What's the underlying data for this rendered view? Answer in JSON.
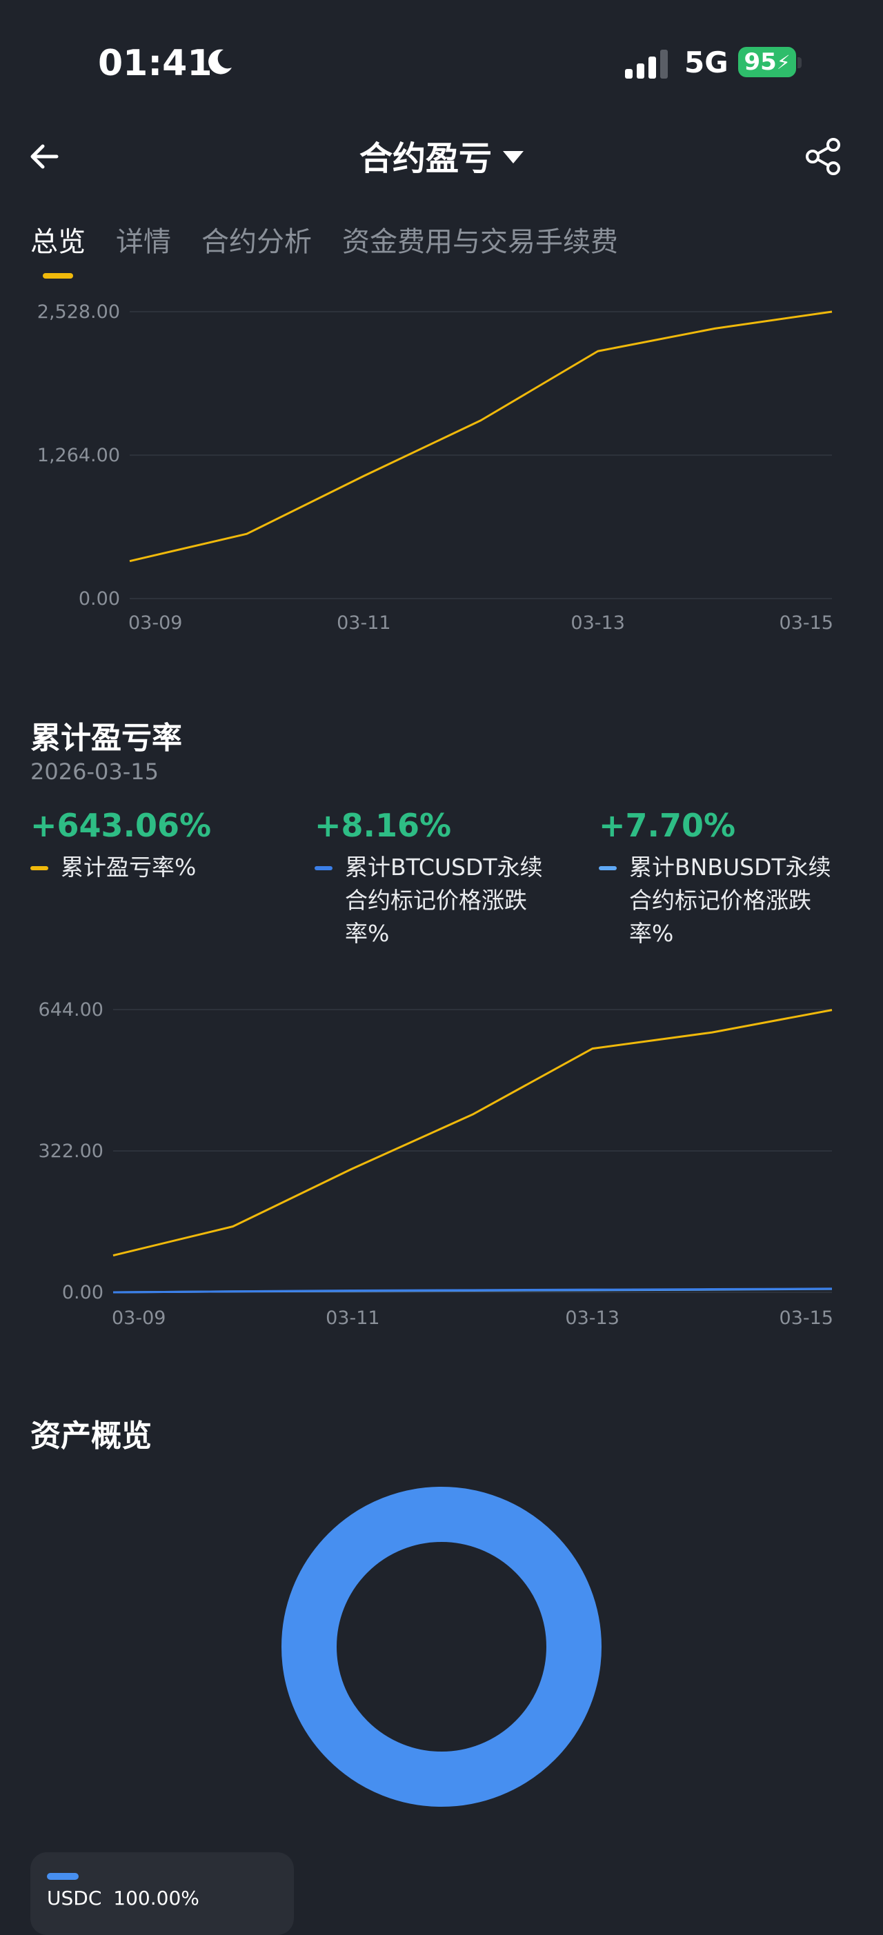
{
  "status_bar": {
    "time": "01:41",
    "network": "5G",
    "battery": "95"
  },
  "header": {
    "title": "合约盈亏"
  },
  "tabs": [
    {
      "label": "总览",
      "active": true
    },
    {
      "label": "详情",
      "active": false
    },
    {
      "label": "合约分析",
      "active": false
    },
    {
      "label": "资金费用与交易手续费",
      "active": false
    }
  ],
  "chart_data": [
    {
      "type": "line",
      "x": [
        "03-09",
        "03-10",
        "03-11",
        "03-12",
        "03-13",
        "03-14",
        "03-15"
      ],
      "series": [
        {
          "values": [
            330,
            570,
            1080,
            1570,
            2180,
            2380,
            2528
          ]
        }
      ],
      "ylim": [
        0,
        2528
      ],
      "yticks": [
        "0.00",
        "1,264.00",
        "2,528.00"
      ],
      "xticks": [
        "03-09",
        "03-11",
        "03-13",
        "03-15"
      ],
      "grid": true
    },
    {
      "type": "line",
      "x": [
        "03-09",
        "03-10",
        "03-11",
        "03-12",
        "03-13",
        "03-14",
        "03-15"
      ],
      "series": [
        {
          "name": "累计盈亏率%",
          "values": [
            84,
            150,
            282,
            405,
            555,
            592,
            643.06
          ]
        },
        {
          "name": "累计BTCUSDT永续合约标记价格涨跌率%",
          "values": [
            0,
            2,
            4,
            5,
            6,
            7,
            8.16
          ]
        },
        {
          "name": "累计BNBUSDT永续合约标记价格涨跌率%",
          "values": [
            0,
            2,
            3,
            4,
            5,
            6,
            7.7
          ]
        }
      ],
      "ylim": [
        0,
        644
      ],
      "yticks": [
        "0.00",
        "322.00",
        "644.00"
      ],
      "xticks": [
        "03-09",
        "03-11",
        "03-13",
        "03-15"
      ],
      "grid": true
    },
    {
      "type": "pie",
      "categories": [
        "USDC"
      ],
      "values": [
        100.0
      ]
    }
  ],
  "cumulative": {
    "title": "累计盈亏率",
    "date": "2026-03-15",
    "stats": [
      {
        "value": "+643.06%",
        "label": "累计盈亏率%",
        "color": "#f0b90b"
      },
      {
        "value": "+8.16%",
        "label": "累计BTCUSDT永续合约标记价格涨跌率%",
        "color": "#3b7fe8"
      },
      {
        "value": "+7.70%",
        "label": "累计BNBUSDT永续合约标记价格涨跌率%",
        "color": "#5fa8f5"
      }
    ]
  },
  "assets": {
    "title": "资产概览",
    "items": [
      {
        "name": "USDC",
        "percent": "100.00%",
        "color": "#478ff0"
      }
    ]
  },
  "colors": {
    "accent": "#f0b90b",
    "positive": "#2ebd85",
    "background": "#1f232b"
  }
}
